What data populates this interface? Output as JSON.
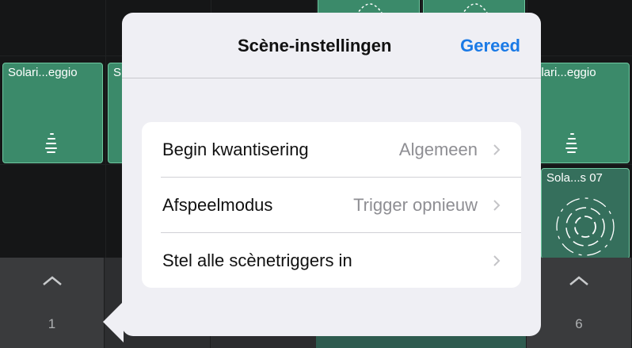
{
  "background_grid": {
    "clips": [
      {
        "label": "Solari...eggio",
        "kind": "arpeggio"
      },
      {
        "label": "S",
        "kind": "arpeggio"
      },
      {
        "label": "olari...eggio",
        "kind": "arpeggio"
      },
      {
        "label": "Sola...s 07",
        "kind": "swirl"
      }
    ],
    "top_clips": [
      {
        "kind": "swirl"
      },
      {
        "kind": "swirl"
      }
    ]
  },
  "bottom_bar": {
    "scenes": [
      {
        "number": "1"
      },
      {
        "number": "6"
      }
    ]
  },
  "popover": {
    "title": "Scène-instellingen",
    "done_label": "Gereed",
    "rows": [
      {
        "label": "Begin kwantisering",
        "value": "Algemeen"
      },
      {
        "label": "Afspeelmodus",
        "value": "Trigger opnieuw"
      },
      {
        "label": "Stel alle scènetriggers in",
        "value": ""
      }
    ]
  },
  "colors": {
    "clip_fill": "#3b8a6a",
    "clip_border": "#6fc7a0",
    "accent": "#1a7ae6",
    "popover_bg": "#efeff4"
  }
}
